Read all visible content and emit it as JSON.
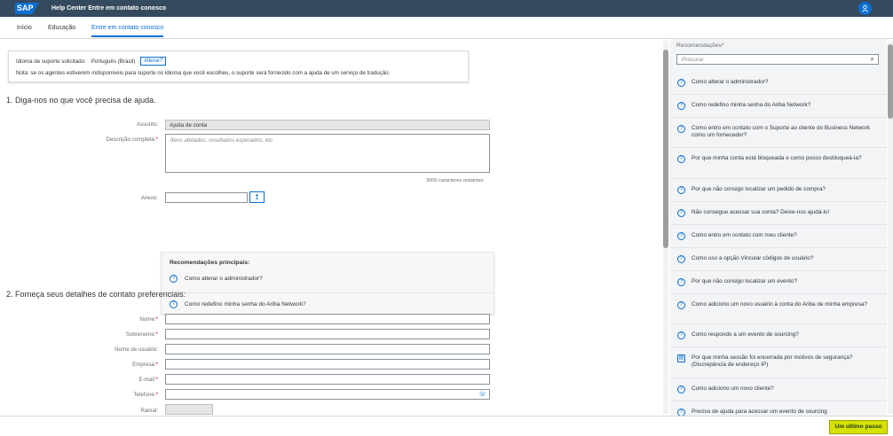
{
  "header": {
    "logo": "SAP",
    "title": "Help Center Entre em contato conosco",
    "user_icon": "user-icon"
  },
  "nav": {
    "tabs": [
      {
        "label": "Início"
      },
      {
        "label": "Educação"
      },
      {
        "label": "Entre em contato conosco",
        "active": true
      }
    ]
  },
  "notice": {
    "lang_label": "Idioma de suporte solicitado:",
    "lang_value": "Português (Brasil)",
    "change_label": "Alterar?",
    "note": "Nota: se os agentes estiverem indisponíveis para suporte no idioma que você escolheu, o suporte será fornecido com a ajuda de um serviço de tradução."
  },
  "section1": {
    "title": "1. Diga-nos no que você precisa de ajuda.",
    "subject_label": "Assunto:",
    "subject_value": "Ajuda de conta",
    "description_label": "Descrição completa:",
    "description_placeholder": "Itens afetados, resultados esperados, etc.",
    "char_count": "3000 caracteres restantes",
    "attachment_label": "Anexo:"
  },
  "top_recommendations": {
    "title": "Recomendações principais:",
    "items": [
      {
        "label": "Como alterar o administrador?"
      },
      {
        "label": "Como redefino minha senha do Ariba Network?"
      }
    ]
  },
  "section2": {
    "title": "2. Forneça seus detalhes de contato preferenciais:",
    "fields": [
      {
        "label": "Nome:",
        "required": "*"
      },
      {
        "label": "Sobrenome:",
        "required": "*"
      },
      {
        "label": "Nome de usuário:",
        "required": ""
      },
      {
        "label": "Empresa:",
        "required": "*"
      },
      {
        "label": "E-mail:",
        "required": "*"
      },
      {
        "label": "Telefone:",
        "required": "*"
      },
      {
        "label": "Ramal:",
        "required": ""
      }
    ]
  },
  "sidebar": {
    "title": "Recomendações*",
    "search_placeholder": "Procurar",
    "items": [
      {
        "label": "Como alterar o administrador?"
      },
      {
        "label": "Como redefino minha senha do Ariba Network?"
      },
      {
        "label": "Como entro em contato com o Suporte ao cliente do Business Network como um fornecedor?"
      },
      {
        "label": "Por que minha conta está bloqueada e como posso desbloqueá-la?"
      },
      {
        "label": "Por que não consigo localizar um pedido de compra?"
      },
      {
        "label": "Não consegue acessar sua conta? Deixe-nos ajudá-lo!"
      },
      {
        "label": "Como entro em contato com meu cliente?"
      },
      {
        "label": "Como uso a opção Vincular códigos de usuário?"
      },
      {
        "label": "Por que não consigo localizar um evento?"
      },
      {
        "label": "Como adiciono um novo usuário à conta do Ariba de minha empresa?"
      },
      {
        "label": "Como respondo a um evento de sourcing?"
      },
      {
        "label": "Por que minha sessão foi encerrada por motivos de segurança? (Discrepância de endereço IP)"
      },
      {
        "label": "Como adiciono um novo cliente?"
      },
      {
        "label": "Preciso de ajuda para acessar um evento de sourcing"
      }
    ]
  },
  "footer": {
    "final_step_label": "Um último passo"
  },
  "colors": {
    "brand": "#354a5f",
    "accent": "#0a6ed1",
    "highlight": "#d6e100"
  }
}
